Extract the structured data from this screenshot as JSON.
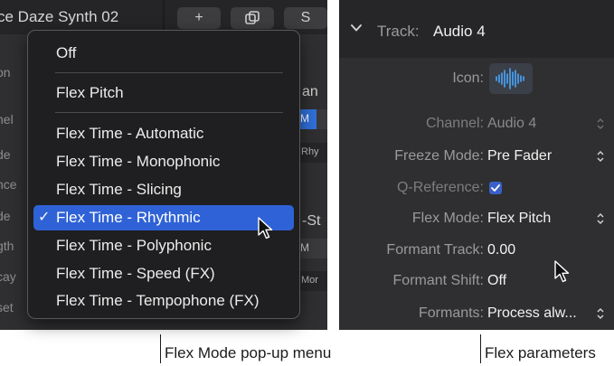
{
  "left_panel": {
    "track_title": "ce Daze Synth 02",
    "header_buttons": [
      "+",
      "S"
    ],
    "side_labels": [
      "on",
      "nel",
      "de",
      "nce",
      "de",
      "gth",
      "cay",
      "set"
    ],
    "peek_labels": [
      "an",
      "-St"
    ],
    "mini_labels": [
      "M",
      "Rhy",
      "M",
      "Mor"
    ]
  },
  "flex_menu": {
    "items": [
      {
        "label": "Off"
      },
      {
        "label": "Flex Pitch"
      },
      {
        "label": "Flex Time - Automatic"
      },
      {
        "label": "Flex Time - Monophonic"
      },
      {
        "label": "Flex Time - Slicing"
      },
      {
        "label": "Flex Time - Rhythmic",
        "selected": true,
        "check": "✓"
      },
      {
        "label": "Flex Time - Polyphonic"
      },
      {
        "label": "Flex Time - Speed (FX)"
      },
      {
        "label": "Flex Time - Tempophone (FX)"
      }
    ],
    "selected_color": "#2f62d6"
  },
  "inspector": {
    "header_label": "Track:",
    "header_value": "Audio 4",
    "rows": [
      {
        "label": "Icon:"
      },
      {
        "label": "Channel:",
        "value": "Audio 4"
      },
      {
        "label": "Freeze Mode:",
        "value": "Pre Fader"
      },
      {
        "label": "Q-Reference:"
      },
      {
        "label": "Flex Mode:",
        "value": "Flex Pitch"
      },
      {
        "label": "Formant Track:",
        "value": "0.00"
      },
      {
        "label": "Formant Shift:",
        "value": "Off"
      },
      {
        "label": "Formants:",
        "value": "Process alw..."
      }
    ],
    "q_reference_checked": true,
    "icon_name": "waveform-icon"
  },
  "captions": {
    "left": "Flex Mode pop-up menu",
    "right": "Flex parameters"
  }
}
